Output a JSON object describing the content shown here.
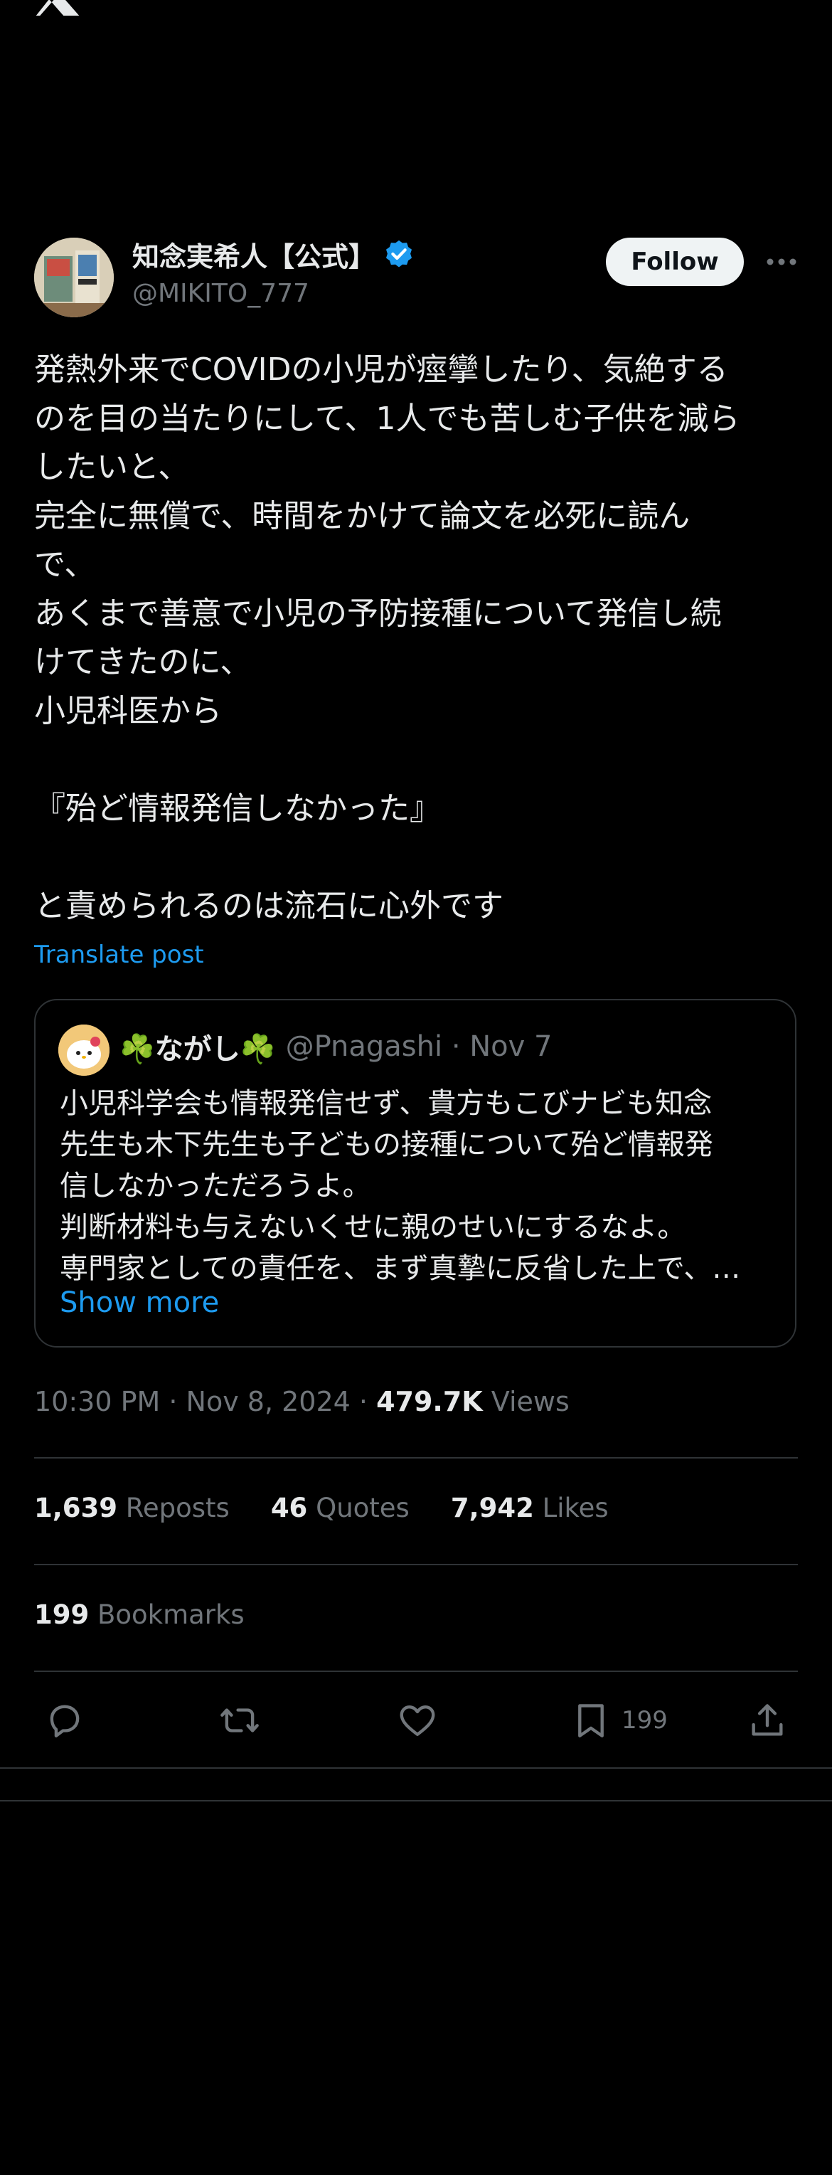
{
  "app": {
    "logo": "x-logo-icon"
  },
  "tweet": {
    "author": {
      "display_name": "知念実希人【公式】",
      "handle": "@MIKITO_777",
      "verified_icon": "verified-badge-icon",
      "verified_color": "#1d9bf0"
    },
    "follow_label": "Follow",
    "more_icon": "more-horizontal-icon",
    "text": "発熱外来でCOVIDの小児が痙攣したり、気絶する\nのを目の当たりにして、1人でも苦しむ子供を減ら\nしたいと、\n完全に無償で、時間をかけて論文を必死に読ん\nで、\nあくまで善意で小児の予防接種について発信し続\nけてきたのに、\n小児科医から\n\n『殆ど情報発信しなかった』\n\nと責められるのは流石に心外です",
    "translate_label": "Translate post",
    "quote": {
      "name": "☘️ながし☘️",
      "meta": "@Pnagashi · Nov 7",
      "text": "小児科学会も情報発信せず、貴方もこびナビも知念\n先生も木下先生も子どもの接種について殆ど情報発\n信しなかっただろうよ。\n判断材料も与えないくせに親のせいにするなよ。\n専門家としての責任を、まず真摯に反省した上で、…",
      "show_more": "Show more"
    },
    "timestamp": "10:30 PM · Nov 8, 2024 · ",
    "views_count": "479.7K",
    "views_label": " Views",
    "stats": {
      "reposts_count": "1,639",
      "reposts_label": " Reposts",
      "quotes_count": "46",
      "quotes_label": " Quotes",
      "likes_count": "7,942",
      "likes_label": " Likes",
      "bookmarks_count": "199",
      "bookmarks_label": " Bookmarks"
    },
    "actions": {
      "reply_icon": "reply-icon",
      "repost_icon": "repost-icon",
      "like_icon": "like-icon",
      "bookmark_icon": "bookmark-icon",
      "bookmark_count": "199",
      "share_icon": "share-icon"
    }
  },
  "colors": {
    "background": "#000000",
    "accent": "#1d9bf0",
    "text": "#e7e9ea",
    "muted": "#71767b",
    "border": "#2f3336"
  }
}
